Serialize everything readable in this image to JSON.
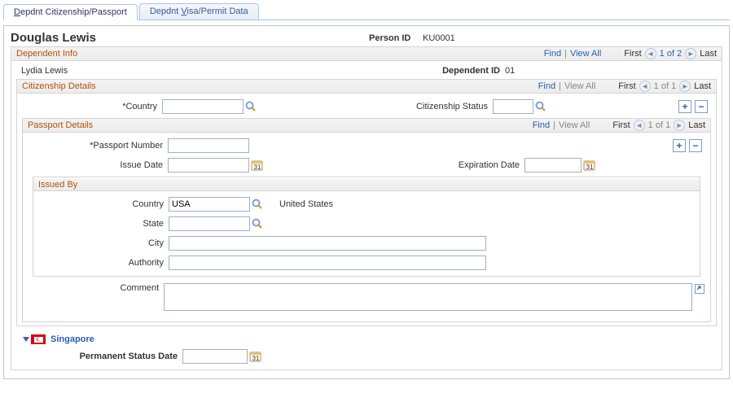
{
  "tabs": {
    "citizenship": "Depdnt Citizenship/Passport",
    "visa": "Depdnt Visa/Permit Data"
  },
  "header": {
    "person_name": "Douglas Lewis",
    "person_id_label": "Person ID",
    "person_id": "KU0001"
  },
  "dependent_info": {
    "title": "Dependent Info",
    "find": "Find",
    "view_all": "View All",
    "first": "First",
    "pager": "1 of 2",
    "last": "Last",
    "dep_name": "Lydia Lewis",
    "dep_id_label": "Dependent ID",
    "dep_id": "01"
  },
  "citizenship": {
    "title": "Citizenship Details",
    "find": "Find",
    "view_all": "View All",
    "first": "First",
    "pager": "1 of 1",
    "last": "Last",
    "country_label": "*Country",
    "country": "",
    "status_label": "Citizenship Status",
    "status": ""
  },
  "passport": {
    "title": "Passport Details",
    "find": "Find",
    "view_all": "View All",
    "first": "First",
    "pager": "1 of 1",
    "last": "Last",
    "number_label": "*Passport Number",
    "number": "",
    "issue_label": "Issue Date",
    "issue": "",
    "expire_label": "Expiration Date",
    "expire": "",
    "issued_by_title": "Issued By",
    "country_label": "Country",
    "country": "USA",
    "country_desc": "United States",
    "state_label": "State",
    "state": "",
    "city_label": "City",
    "city": "",
    "authority_label": "Authority",
    "authority": "",
    "comment_label": "Comment",
    "comment": ""
  },
  "singapore": {
    "label": "Singapore",
    "perm_status_label": "Permanent Status Date",
    "perm_status": ""
  }
}
